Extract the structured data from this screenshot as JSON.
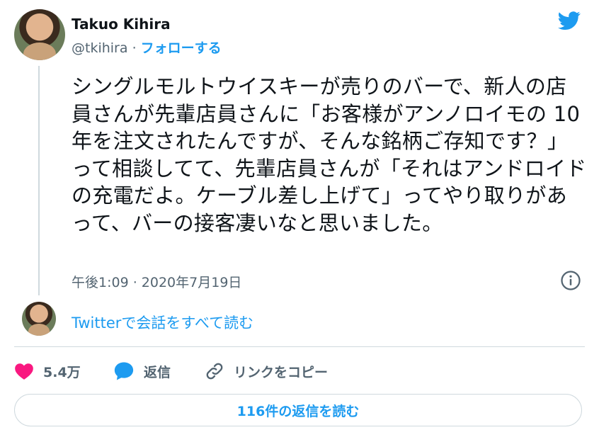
{
  "author": {
    "name": "Takuo Kihira",
    "handle": "@tkihira",
    "separator": "·",
    "follow_label": "フォローする"
  },
  "tweet": {
    "text": "シングルモルトウイスキーが売りのバーで、新人の店員さんが先輩店員さんに「お客様がアンノロイモの 10 年を注文されたんですが、そんな銘柄ご存知です？」って相談してて、先輩店員さんが「それはアンドロイドの充電だよ。ケーブル差し上げて」ってやり取りがあって、バーの接客凄いなと思いました。",
    "timestamp": "午後1:09 · 2020年7月19日"
  },
  "conversation": {
    "read_label": "Twitterで会話をすべて読む"
  },
  "actions": {
    "likes": "5.4万",
    "reply_label": "返信",
    "copy_link_label": "リンクをコピー"
  },
  "replies": {
    "read_label": "116件の返信を読む"
  },
  "icons": {
    "brand": "twitter-bird-icon",
    "info": "info-icon",
    "like": "heart-icon",
    "reply": "speech-bubble-icon",
    "link": "link-icon"
  },
  "colors": {
    "accent": "#1d9bf0",
    "like": "#f91880",
    "muted_text": "#536471",
    "text": "#0f1419",
    "border": "#cfd9de"
  }
}
